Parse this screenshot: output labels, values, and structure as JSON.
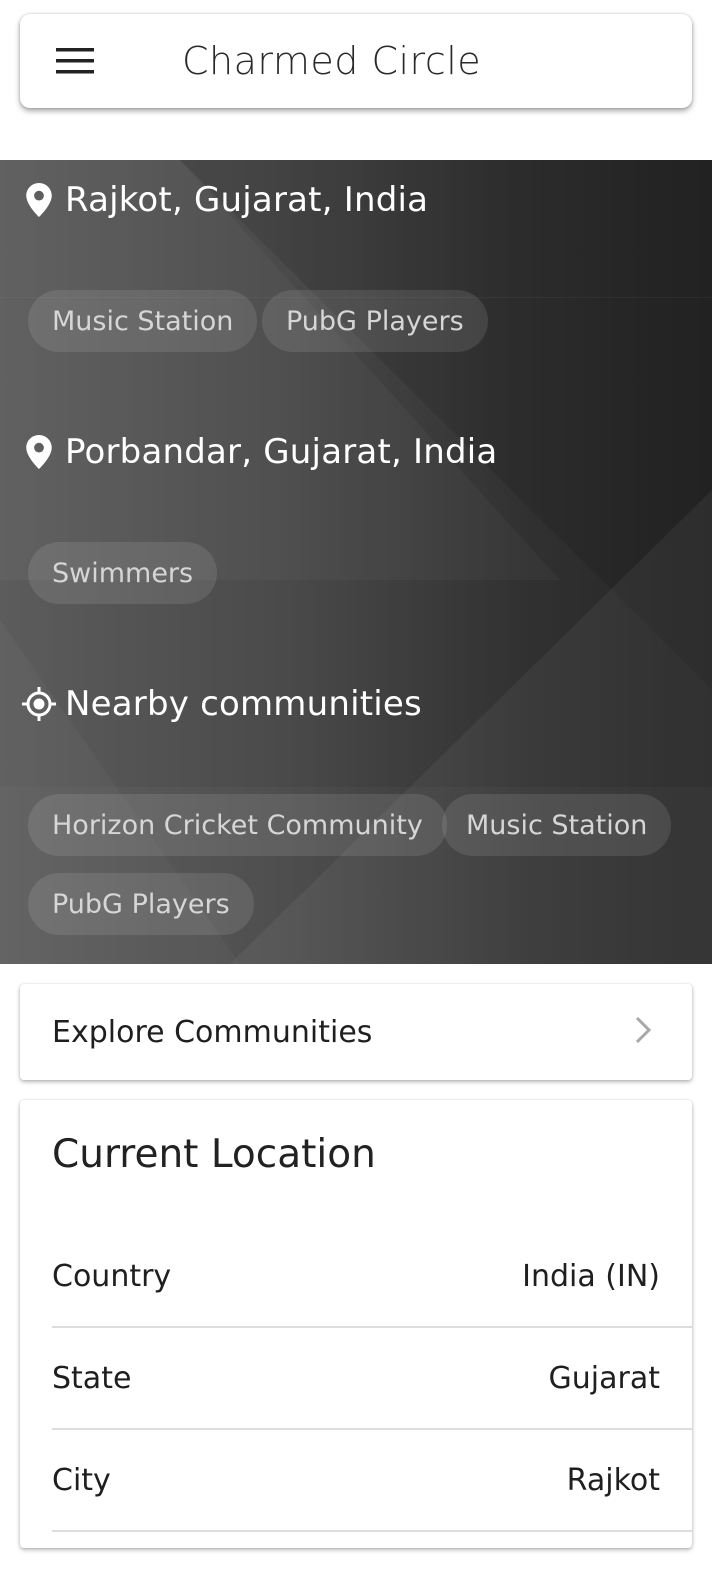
{
  "appbar": {
    "title": "Charmed Circle",
    "menu_icon": "hamburger-menu-icon"
  },
  "sections": [
    {
      "icon": "location-pin-icon",
      "title": "Rajkot, Gujarat, India",
      "chips": [
        "Music Station",
        "PubG Players"
      ]
    },
    {
      "icon": "location-pin-icon",
      "title": "Porbandar, Gujarat, India",
      "chips": [
        "Swimmers"
      ]
    },
    {
      "icon": "my-location-icon",
      "title": "Nearby communities",
      "chips": [
        "Horizon Cricket Community",
        "Music Station",
        "PubG Players"
      ]
    }
  ],
  "explore": {
    "label": "Explore Communities",
    "icon": "chevron-right-icon"
  },
  "location": {
    "title": "Current Location",
    "rows": [
      {
        "key": "Country",
        "value": "India (IN)"
      },
      {
        "key": "State",
        "value": "Gujarat"
      },
      {
        "key": "City",
        "value": "Rajkot"
      }
    ]
  },
  "colors": {
    "hero_dark": "#262626",
    "hero_light": "#5c5c5c",
    "chip_text": "#d6d6d6"
  }
}
